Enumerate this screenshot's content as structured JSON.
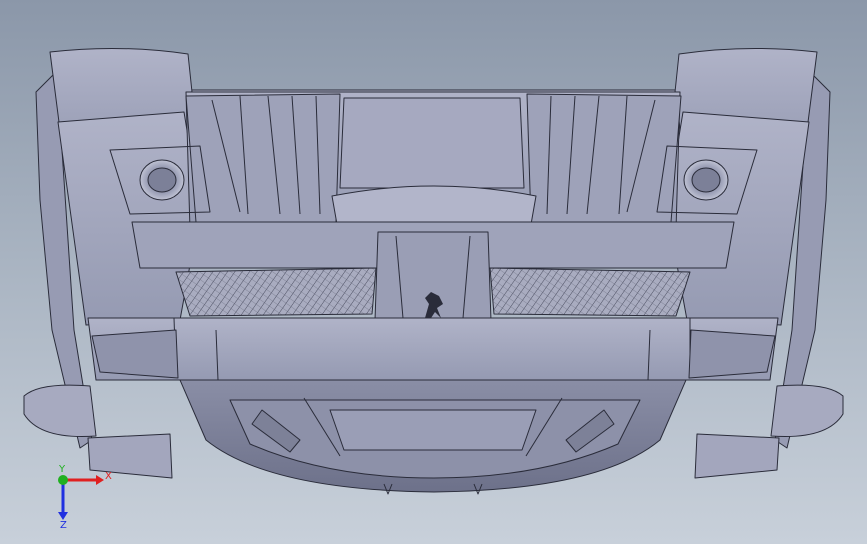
{
  "viewport": {
    "background_top": "#8b97a9",
    "background_bottom": "#c8d0da",
    "model_fill": "#a3a7be",
    "model_edge": "#2a2c3a"
  },
  "model": {
    "icon": "car-rear-diffuser-model",
    "emblem_icon": "prancing-horse-emblem"
  },
  "triad": {
    "x_label": "X",
    "y_label": "Y",
    "z_label": "Z",
    "x_color": "#e02020",
    "y_color": "#20b020",
    "z_color": "#2030e0"
  }
}
